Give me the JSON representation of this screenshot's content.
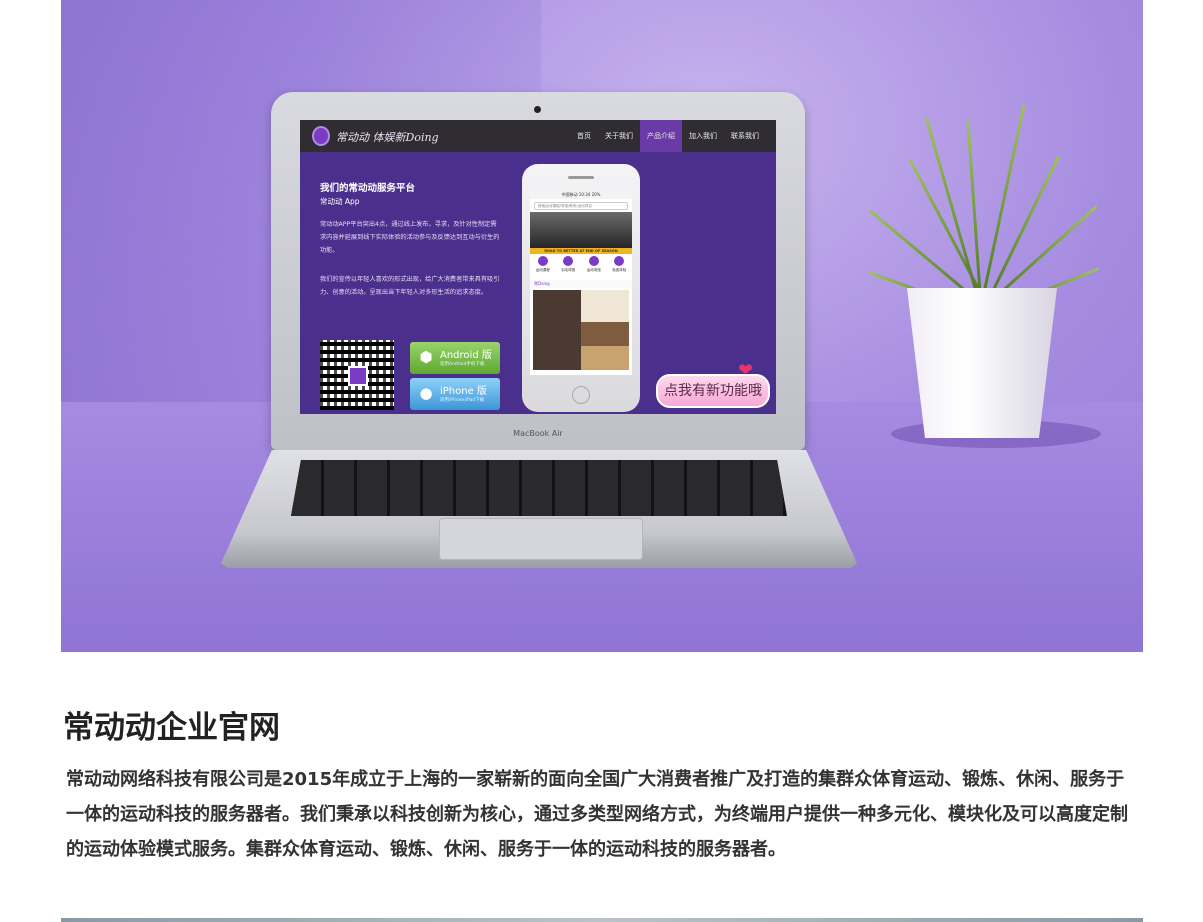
{
  "mockup": {
    "nav": {
      "logo_text": "常动动 体娱新Doing",
      "items": [
        "首页",
        "关于我们",
        "产品介绍",
        "加入我们",
        "联系我们"
      ],
      "active_item": "产品介绍"
    },
    "heading": "我们的常动动服务平台",
    "subheading": "常动动 App",
    "paragraphs": [
      "常动动APP平台突出4点，通过线上发布，寻求，及针对性制定需求内容并延展到线下实际体验的活动参与及反馈达到互动与衍生的功能。",
      "我们的宣传以年轻人喜欢的形式出现，给广大消费者带来具有吸引力、创意的活动。呈现出当下年轻人对多形生活的追求态度。"
    ],
    "download_buttons": [
      {
        "name": "Android 版",
        "desc": "适用Android手机下载"
      },
      {
        "name": "iPhone 版",
        "desc": "适用iPhone/iPad下载"
      }
    ],
    "promo_badge": "点我有新功能哦",
    "laptop_brand": "MacBook Air",
    "phone": {
      "status": "中国移动  10:34  20%",
      "search_placeholder": "搜索运动课程/场馆/教练/运动项目",
      "strip_text": "ROAD TO BETTER AT END OF SEASON",
      "categories": [
        "运动课程",
        "羽毛球馆",
        "运动场馆",
        "免费体验"
      ],
      "section_title": "常Doing"
    }
  },
  "company": {
    "title": "常动动企业官网",
    "description": "常动动网络科技有限公司是2015年成立于上海的一家崭新的面向全国广大消费者推广及打造的集群众体育运动、锻炼、休闲、服务于一体的运动科技的服务器者。我们秉承以科技创新为核心，通过多类型网络方式，为终端用户提供一种多元化、模块化及可以高度定制的运动体验模式服务。集群众体育运动、锻炼、休闲、服务于一体的运动科技的服务器者。"
  },
  "colors": {
    "screen_purple": "#4b2f8c",
    "nav_dark": "#2f2d31",
    "android_green": "#5da832",
    "iphone_blue": "#3b97d8",
    "backdrop": "#a68ce0"
  }
}
